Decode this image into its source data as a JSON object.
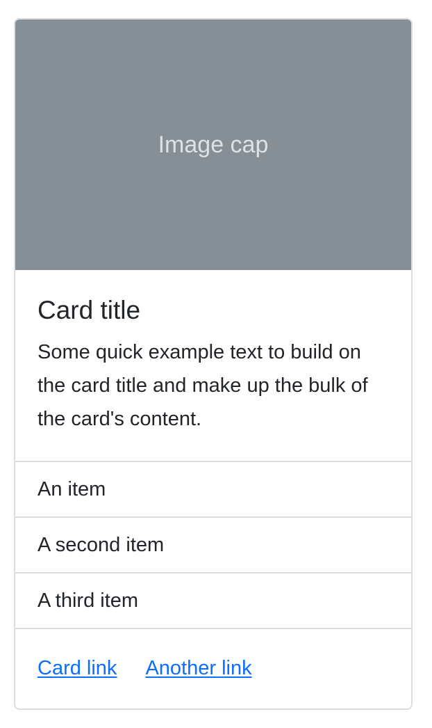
{
  "card": {
    "image_cap": "Image cap",
    "title": "Card title",
    "text": "Some quick example text to build on the card title and make up the bulk of the card's content.",
    "list_items": [
      {
        "label": "An item"
      },
      {
        "label": "A second item"
      },
      {
        "label": "A third item"
      }
    ],
    "links": [
      {
        "label": "Card link"
      },
      {
        "label": "Another link"
      }
    ]
  },
  "colors": {
    "image_background": "#868e96",
    "link": "#0d6efd",
    "border": "#dcdee0",
    "text": "#212529"
  }
}
